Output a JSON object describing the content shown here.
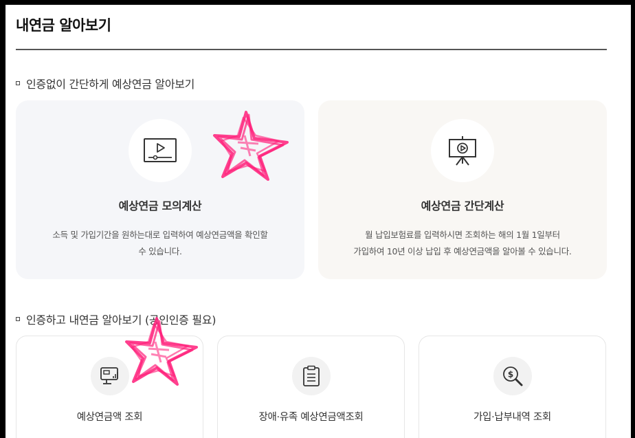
{
  "page": {
    "title": "내연금 알아보기"
  },
  "section_no_auth": {
    "heading": "인증없이 간단하게 예상연금 알아보기",
    "cards": [
      {
        "icon": "video-player-icon",
        "title": "예상연금 모의계산",
        "desc_lines": [
          "소득 및 가입기간을 원하는대로 입력하여 예상연금액을 확인할",
          "수 있습니다."
        ]
      },
      {
        "icon": "presentation-play-icon",
        "title": "예상연금 간단계산",
        "desc_lines": [
          "월 납입보험료를 입력하시면 조회하는 해의 1월 1일부터",
          "가입하여 10년 이상 납입 후 예상연금액을 알아볼 수 있습니다."
        ]
      }
    ]
  },
  "section_auth": {
    "heading": "인증하고 내연금 알아보기 (공인인증 필요)",
    "cards": [
      {
        "icon": "monitor-chart-icon",
        "title": "예상연금액 조회"
      },
      {
        "icon": "clipboard-list-icon",
        "title": "장애·유족 예상연금액조회"
      },
      {
        "icon": "magnifier-dollar-icon",
        "title": "가입·납부내역 조회"
      }
    ]
  },
  "colors": {
    "card_a_bg": "#f5f6f9",
    "card_b_bg": "#f9f7f4",
    "annotation_star": "#ff1f7a"
  }
}
